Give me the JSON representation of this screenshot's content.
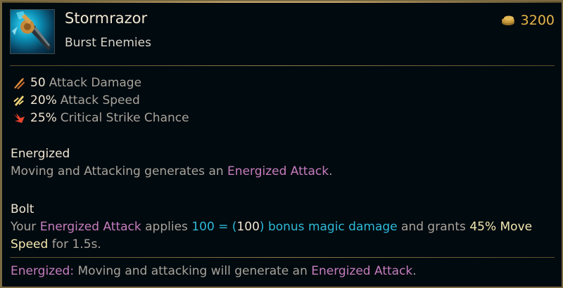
{
  "item": {
    "name": "Stormrazor",
    "tag": "Burst Enemies",
    "cost": "3200",
    "icon": "stormrazor-sword-icon"
  },
  "stats": [
    {
      "value": "50",
      "label": "Attack Damage",
      "icon": "attack-damage-icon"
    },
    {
      "value": "20%",
      "label": "Attack Speed",
      "icon": "attack-speed-icon"
    },
    {
      "value": "25%",
      "label": "Critical Strike Chance",
      "icon": "critical-strike-icon"
    }
  ],
  "passives": {
    "energized": {
      "title": "Energized",
      "text_before": "Moving and Attacking generates an ",
      "highlight": "Energized Attack",
      "text_after": "."
    },
    "bolt": {
      "title": "Bolt",
      "p1": "Your ",
      "energized": "Energized Attack",
      "p2": " applies ",
      "dmg_a": "100 = (",
      "dmg_b": "100",
      "dmg_c": ") bonus magic damage",
      "p3": " and grants ",
      "ms": "45% Move Speed",
      "p4": " for 1.5s."
    }
  },
  "footer": {
    "keyword": "Energized:",
    "text": " Moving and attacking will generate an ",
    "highlight": "Energized Attack",
    "end": "."
  },
  "colors": {
    "gold_border": "#c8aa6e",
    "keyword_pink": "#c77dbf",
    "magic_cyan": "#2fb9d8",
    "cost_gold": "#e8b54a"
  }
}
